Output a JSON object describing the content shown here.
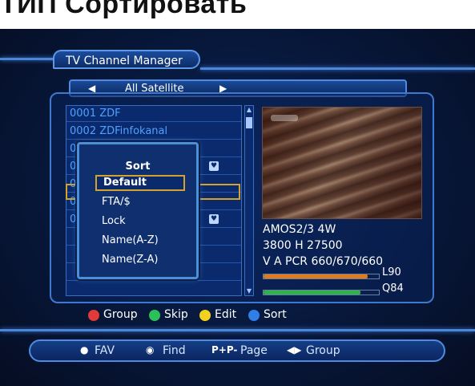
{
  "top_caption": "ТИП  Сортировать",
  "window_title": "TV Channel Manager",
  "satellite": {
    "name": "All Satellite",
    "left_arrow": "◀",
    "right_arrow": "▶"
  },
  "channels": [
    {
      "label": "0001 ZDF"
    },
    {
      "label": "0002 ZDFinfokanal"
    },
    {
      "label": "0"
    },
    {
      "label": "0"
    },
    {
      "label": "0"
    },
    {
      "label": "0"
    },
    {
      "label": "0"
    }
  ],
  "sort_popup": {
    "title": "Sort",
    "items": [
      "Default",
      "FTA/$",
      "Lock",
      "Name(A-Z)",
      "Name(Z-A)"
    ],
    "selected_index": 0
  },
  "channel_info": {
    "line1": "AMOS2/3 4W",
    "line2": "3800 H 27500",
    "line3": "V A PCR 660/670/660"
  },
  "signal": {
    "level_label": "L90",
    "quality_label": "Q84",
    "level_value": 90,
    "quality_value": 84,
    "level_color": "#e07a1a",
    "quality_color": "#30b24a"
  },
  "legend": {
    "group": "Group",
    "skip": "Skip",
    "edit": "Edit",
    "sort": "Sort",
    "group_color": "#e03a3a",
    "skip_color": "#2cc05a",
    "edit_color": "#f2d21e",
    "sort_color": "#2f7fe6"
  },
  "hints": {
    "fav": "FAV",
    "find": "Find",
    "page_key": "P+P-",
    "page": "Page",
    "group_key": "◀▶",
    "group": "Group"
  }
}
